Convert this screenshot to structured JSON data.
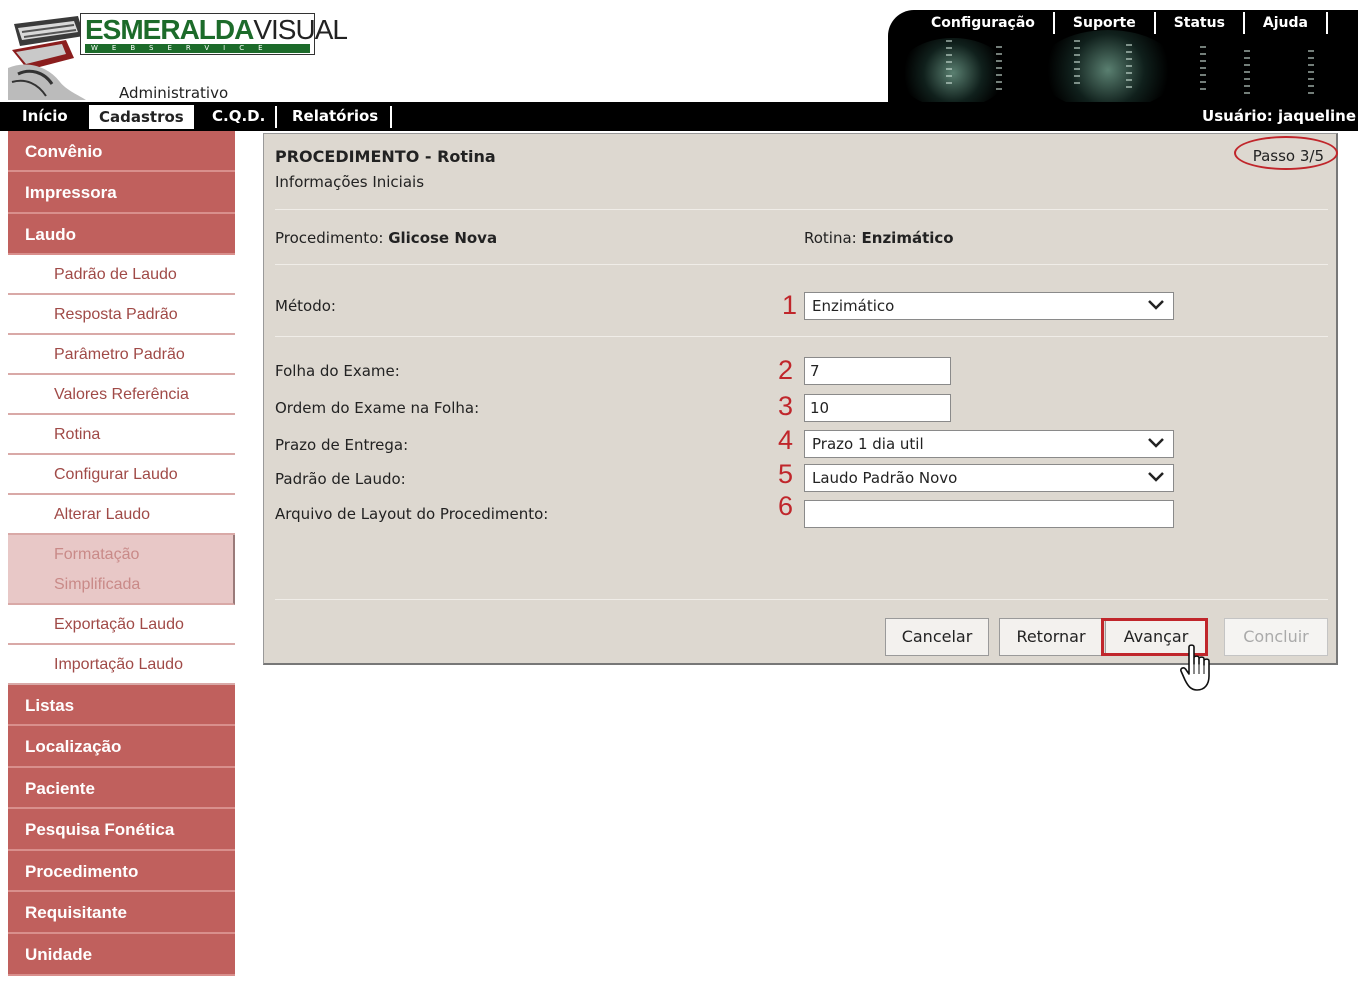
{
  "header": {
    "logo_brand": "ESMERALDA",
    "logo_brand_2": "VISUAL",
    "logo_strip": "WEBSERVICE",
    "subtitle": "Administrativo",
    "top_links": [
      "Configuração",
      "Suporte",
      "Status",
      "Ajuda"
    ]
  },
  "nav": {
    "items": [
      "Início",
      "Cadastros",
      "C.Q.D.",
      "Relatórios"
    ],
    "active": "Cadastros",
    "user": "Usuário: jaqueline"
  },
  "sidebar": {
    "convenio": "Convênio",
    "impressora": "Impressora",
    "laudo": "Laudo",
    "laudo_items": [
      "Padrão de Laudo",
      "Resposta Padrão",
      "Parâmetro Padrão",
      "Valores Referência",
      "Rotina",
      "Configurar Laudo",
      "Alterar Laudo"
    ],
    "selected_line1": "Formatação",
    "selected_line2": "Simplificada",
    "laudo_items_2": [
      "Exportação Laudo",
      "Importação Laudo"
    ],
    "bottom_items": [
      "Listas",
      "Localização",
      "Paciente",
      "Pesquisa Fonética",
      "Procedimento",
      "Requisitante",
      "Unidade"
    ]
  },
  "panel": {
    "title": "PROCEDIMENTO - Rotina",
    "subtitle": "Informações Iniciais",
    "step": "Passo 3/5",
    "procedimento_label": "Procedimento:",
    "procedimento_value": "Glicose Nova",
    "rotina_label": "Rotina:",
    "rotina_value": "Enzimático",
    "metodo_label": "Método:",
    "metodo_value": "Enzimático",
    "folha_label": "Folha do Exame:",
    "folha_value": "7",
    "ordem_label": "Ordem do Exame na Folha:",
    "ordem_value": "10",
    "prazo_label": "Prazo de Entrega:",
    "prazo_value": "Prazo 1 dia util",
    "padrao_label": "Padrão de Laudo:",
    "padrao_value": "Laudo Padrão Novo",
    "arquivo_label": "Arquivo de Layout do Procedimento:",
    "arquivo_value": "",
    "markers": [
      "1",
      "2",
      "3",
      "4",
      "5",
      "6"
    ]
  },
  "buttons": {
    "cancelar": "Cancelar",
    "retornar": "Retornar",
    "avancar": "Avançar",
    "concluir": "Concluir"
  },
  "colors": {
    "sidebar_main": "#c0605d",
    "sidebar_sub_text": "#a04a47",
    "panel_bg": "#ddd8d0",
    "highlight_red": "#c0262b"
  }
}
